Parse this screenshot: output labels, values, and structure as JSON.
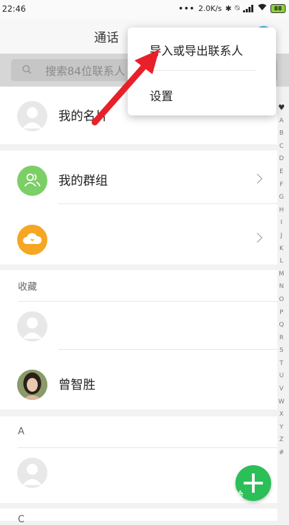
{
  "status_bar": {
    "time": "22:46",
    "net_speed": "2.0K/s",
    "battery": "88",
    "icons": [
      "more-dots-icon",
      "bluetooth-icon",
      "mute-icon",
      "signal-icon",
      "wifi-icon",
      "battery-icon"
    ]
  },
  "header": {
    "title": "通话"
  },
  "search": {
    "placeholder": "搜索84位联系人"
  },
  "my_card": {
    "label": "我的名片"
  },
  "groups": {
    "label": "我的群组",
    "icon_color": "#7ccf66"
  },
  "cloud": {
    "label": "",
    "icon_color": "#f5a623"
  },
  "favorites": {
    "header": "收藏",
    "contacts": [
      "",
      "曾智胜"
    ]
  },
  "section_a": {
    "header": "A",
    "contacts": [
      ""
    ]
  },
  "section_next": {
    "header": "C"
  },
  "menu": {
    "items": [
      "导入或导出联系人",
      "设置"
    ]
  },
  "alpha_index": [
    "♥",
    "A",
    "B",
    "C",
    "D",
    "E",
    "F",
    "G",
    "H",
    "I",
    "J",
    "K",
    "L",
    "M",
    "N",
    "O",
    "P",
    "Q",
    "R",
    "S",
    "T",
    "U",
    "V",
    "W",
    "X",
    "Y",
    "Z",
    "#"
  ],
  "watermark": "Bai经验",
  "colors": {
    "accent_green": "#2bbf58",
    "arrow_red": "#e8202a"
  }
}
